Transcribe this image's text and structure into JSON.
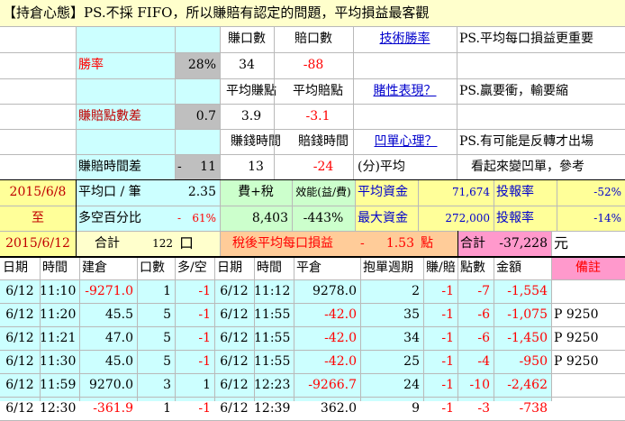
{
  "title": "【持倉心態】PS.不採 FIFO，所以賺賠有認定的問題，平均損益最客觀",
  "header": {
    "win_count_label": "賺口數",
    "loss_count_label": "賠口數",
    "tech_win_rate_link": "技術勝率",
    "note1": "PS.平均每口損益更重要",
    "win_rate_label": "勝率",
    "win_rate_value": "28%",
    "win_count": "34",
    "loss_count": "-88",
    "avg_win_pts_label": "平均賺點",
    "avg_loss_pts_label": "平均賠點",
    "gambler_link": "賭性表現？",
    "note2": "PS.贏要衝，輸要縮",
    "pts_diff_label": "賺賠點數差",
    "pts_diff_value": "0.7",
    "avg_win_pts": "3.9",
    "avg_loss_pts": "-3.1",
    "win_time_label": "賺錢時間",
    "loss_time_label": "賠錢時間",
    "concave_link": "凹單心理？",
    "note3": "PS.有可能是反轉才出場",
    "time_diff_label": "賺賠時間差",
    "time_diff_dash": "-",
    "time_diff_value": "11",
    "win_time": "13",
    "loss_time": "-24",
    "minutes_avg_label": "(分)平均",
    "note4": "看起來變凹單，參考"
  },
  "summary": {
    "date_from": "2015/6/8",
    "to_label": "至",
    "date_to": "2015/6/12",
    "avg_per_trade_label": "平均口 / 筆",
    "avg_per_trade_value": "2.35",
    "fee_tax_label": "費+稅",
    "efficiency_label": "效能(益/費)",
    "avg_capital_label": "平均資金",
    "avg_capital_value": "71,674",
    "roi_label": "投報率",
    "roi_avg_value": "-52%",
    "long_short_label": "多空百分比",
    "long_short_dash": "-",
    "long_short_value": "61%",
    "fee_tax_value": "8,403",
    "efficiency_value": "-443%",
    "max_capital_label": "最大資金",
    "max_capital_value": "272,000",
    "roi_max_value": "-14%",
    "total_label": "合計",
    "total_lots": "122",
    "lots_unit": "口",
    "after_tax_label": "稅後平均每口損益",
    "after_tax_dash": "-",
    "after_tax_value": "1.53",
    "points_unit": "點",
    "grand_total_label": "合計",
    "grand_total_value": "-37,228",
    "currency_unit": "元"
  },
  "table": {
    "columns": [
      "日期",
      "時間",
      "建倉",
      "口數",
      "多/空",
      "日期",
      "時間",
      "平倉",
      "抱單週期",
      "賺/賠",
      "點數",
      "金額",
      "備註"
    ],
    "rows": [
      [
        "6/12",
        "11:10",
        "-9271.0",
        "1",
        "-1",
        "6/12",
        "11:12",
        "9278.0",
        "2",
        "-1",
        "-7",
        "-1,554",
        ""
      ],
      [
        "6/12",
        "11:20",
        "45.5",
        "5",
        "-1",
        "6/12",
        "11:55",
        "-42.0",
        "35",
        "-1",
        "-6",
        "-1,075",
        "P 9250"
      ],
      [
        "6/12",
        "11:21",
        "47.0",
        "5",
        "-1",
        "6/12",
        "11:55",
        "-42.0",
        "34",
        "-1",
        "-6",
        "-1,450",
        "P 9250"
      ],
      [
        "6/12",
        "11:30",
        "45.0",
        "5",
        "-1",
        "6/12",
        "11:55",
        "-42.0",
        "25",
        "-1",
        "-4",
        "-950",
        "P 9250"
      ],
      [
        "6/12",
        "11:59",
        "9270.0",
        "3",
        "1",
        "6/12",
        "12:23",
        "-9266.7",
        "24",
        "-1",
        "-10",
        "-2,462",
        ""
      ],
      [
        "6/12",
        "12:30",
        "-361.9",
        "1",
        "-1",
        "6/12",
        "12:39",
        "362.0",
        "9",
        "-1",
        "-3",
        "-738",
        ""
      ]
    ]
  },
  "colors": {
    "title_bg": "#ffffcc",
    "cyan": "#ccffff",
    "gray": "#bfbfbf",
    "yellow": "#ffff99",
    "light_yellow": "#ffffcc",
    "green": "#ccffcc",
    "orange": "#ffcc99",
    "pink": "#ff99cc",
    "red": "#ff0000"
  }
}
